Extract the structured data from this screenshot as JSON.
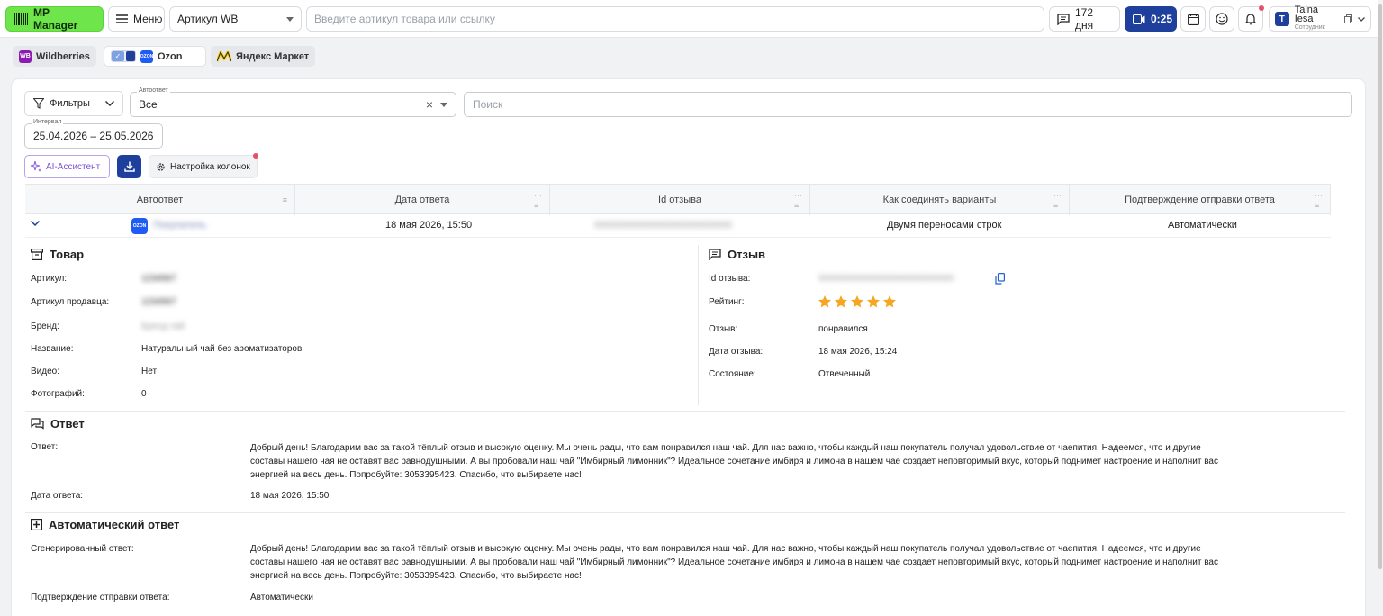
{
  "topbar": {
    "logo": "MP Manager",
    "menu": "Меню",
    "article_select": "Артикул WB",
    "search_placeholder": "Введите артикул товара или ссылку",
    "days": "172 дня",
    "timer": "0:25",
    "user_initial": "T",
    "user_name": "Taina Iesa",
    "user_role": "Сотрудник"
  },
  "marketplaces": [
    {
      "label": "Wildberries",
      "badge": "WB",
      "color": "#8a1cb0"
    },
    {
      "label": "Ozon",
      "badge": "OZON",
      "color": "#1f5cf5"
    },
    {
      "label": "Яндекс Маркет",
      "badge": "",
      "color": "#f5d000"
    }
  ],
  "filters": {
    "filters_btn": "Фильтры",
    "autoreply_label": "Автоответ",
    "autoreply_value": "Все",
    "search_placeholder": "Поиск",
    "interval_label": "Интервал",
    "interval_value": "25.04.2026 – 25.05.2026",
    "ai_btn": "AI-Ассистент",
    "columns_btn": "Настройка колонок"
  },
  "table": {
    "headers": [
      "Автоответ",
      "Дата ответа",
      "Id отзыва",
      "Как соединять варианты",
      "Подтверждение отправки ответа"
    ],
    "row": {
      "name": "Покупатель",
      "date": "18 мая 2026, 15:50",
      "id": "0000000000000000000000000",
      "join": "Двумя переносами строк",
      "confirm": "Автоматически"
    }
  },
  "product": {
    "title": "Товар",
    "fields": [
      {
        "label": "Артикул:",
        "value": "1234567"
      },
      {
        "label": "Артикул продавца:",
        "value": "1234567"
      },
      {
        "label": "Бренд:",
        "value": "Бренд чай"
      },
      {
        "label": "Название:",
        "value": "Натуральный чай без ароматизаторов"
      },
      {
        "label": "Видео:",
        "value": "Нет"
      },
      {
        "label": "Фотографий:",
        "value": "0"
      }
    ]
  },
  "review": {
    "title": "Отзыв",
    "id_label": "Id отзыва:",
    "id_value": "000000000000000000000000000",
    "rating_label": "Рейтинг:",
    "rating": 5,
    "text_label": "Отзыв:",
    "text_value": "понравился",
    "date_label": "Дата отзыва:",
    "date_value": "18 мая 2026, 15:24",
    "state_label": "Состояние:",
    "state_value": "Отвеченный"
  },
  "answer": {
    "title": "Ответ",
    "label": "Ответ:",
    "text": "Добрый день! Благодарим вас за такой тёплый отзыв и высокую оценку. Мы очень рады, что вам понравился наш чай. Для нас важно, чтобы каждый наш покупатель получал удовольствие от чаепития. Надеемся, что и другие составы нашего чая не оставят вас равнодушными. А вы пробовали наш чай \"Имбирный лимонник\"? Идеальное сочетание имбиря и лимона в нашем чае создает неповторимый вкус, который поднимет настроение и наполнит вас энергией на весь день. Попробуйте: 3053395423. Спасибо, что выбираете нас!",
    "date_label": "Дата ответа:",
    "date_value": "18 мая 2026, 15:50"
  },
  "auto": {
    "title": "Автоматический ответ",
    "label": "Сгенерированный ответ:",
    "text": "Добрый день! Благодарим вас за такой тёплый отзыв и высокую оценку. Мы очень рады, что вам понравился наш чай. Для нас важно, чтобы каждый наш покупатель получал удовольствие от чаепития. Надеемся, что и другие составы нашего чая не оставят вас равнодушными. А вы пробовали наш чай \"Имбирный лимонник\"? Идеальное сочетание имбиря и лимона в нашем чае создает неповторимый вкус, который поднимет настроение и наполнит вас энергией на весь день. Попробуйте: 3053395423. Спасибо, что выбираете нас!",
    "confirm_label": "Подтверждение отправки ответа:",
    "confirm_value": "Автоматически"
  },
  "colors": {
    "accent": "#1e3f9c",
    "logo": "#6ee54a",
    "star": "#f5a623",
    "ai": "#7b4fd6"
  }
}
